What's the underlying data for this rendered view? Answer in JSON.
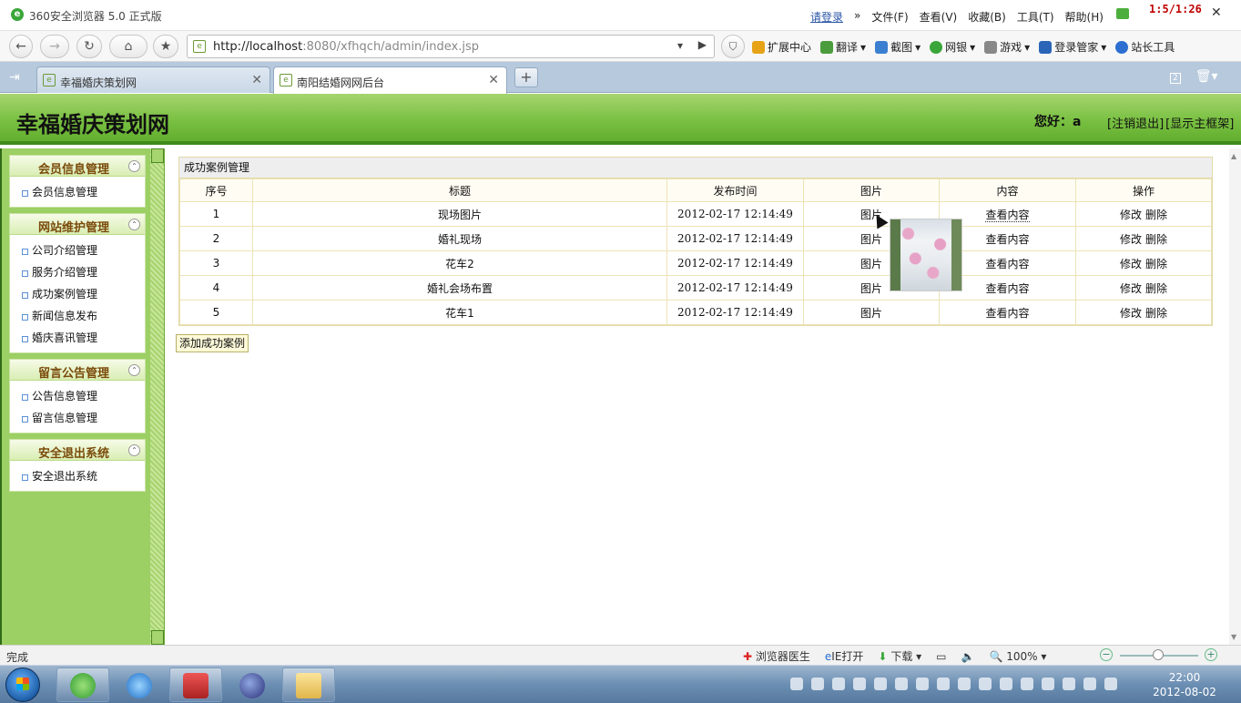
{
  "browser": {
    "title": "360安全浏览器 5.0 正式版",
    "menus": [
      "请登录",
      "»",
      "文件(F)",
      "查看(V)",
      "收藏(B)",
      "工具(T)",
      "帮助(H)"
    ],
    "counter": "1:5/1:26",
    "url_host": "http://localhost",
    "url_rest": ":8080/xfhqch/admin/index.jsp",
    "toolbar": [
      "扩展中心",
      "翻译",
      "截图",
      "网银",
      "游戏",
      "登录管家",
      "站长工具"
    ],
    "tabs": [
      {
        "label": "幸福婚庆策划网"
      },
      {
        "label": "南阳结婚网网后台"
      }
    ],
    "tab_count_badge": "2"
  },
  "site": {
    "title": "幸福婚庆策划网",
    "greeting": "您好：a",
    "logout_link": "[注销退出]",
    "frame_link": "[显示主框架]"
  },
  "sidebar": {
    "groups": [
      {
        "title": "会员信息管理",
        "items": [
          "会员信息管理"
        ]
      },
      {
        "title": "网站维护管理",
        "items": [
          "公司介绍管理",
          "服务介绍管理",
          "成功案例管理",
          "新闻信息发布",
          "婚庆喜讯管理"
        ]
      },
      {
        "title": "留言公告管理",
        "items": [
          "公告信息管理",
          "留言信息管理"
        ]
      },
      {
        "title": "安全退出系统",
        "items": [
          "安全退出系统"
        ]
      }
    ]
  },
  "main": {
    "panel_title": "成功案例管理",
    "columns": [
      "序号",
      "标题",
      "发布时间",
      "图片",
      "内容",
      "操作"
    ],
    "rows": [
      {
        "no": "1",
        "title": "现场图片",
        "time": "2012-02-17 12:14:49",
        "pic": "图片",
        "content": "查看内容",
        "edit": "修改",
        "del": "删除"
      },
      {
        "no": "2",
        "title": "婚礼现场",
        "time": "2012-02-17 12:14:49",
        "pic": "图片",
        "content": "查看内容",
        "edit": "修改",
        "del": "删除"
      },
      {
        "no": "3",
        "title": "花车2",
        "time": "2012-02-17 12:14:49",
        "pic": "图片",
        "content": "查看内容",
        "edit": "修改",
        "del": "删除"
      },
      {
        "no": "4",
        "title": "婚礼会场布置",
        "time": "2012-02-17 12:14:49",
        "pic": "图片",
        "content": "查看内容",
        "edit": "修改",
        "del": "删除"
      },
      {
        "no": "5",
        "title": "花车1",
        "time": "2012-02-17 12:14:49",
        "pic": "图片",
        "content": "查看内容",
        "edit": "修改",
        "del": "删除"
      }
    ],
    "add_button": "添加成功案例"
  },
  "status": {
    "text": "完成",
    "items": [
      "浏览器医生",
      "IE打开",
      "下载"
    ],
    "zoom": "100%"
  },
  "taskbar": {
    "time": "22:00",
    "date": "2012-08-02"
  }
}
